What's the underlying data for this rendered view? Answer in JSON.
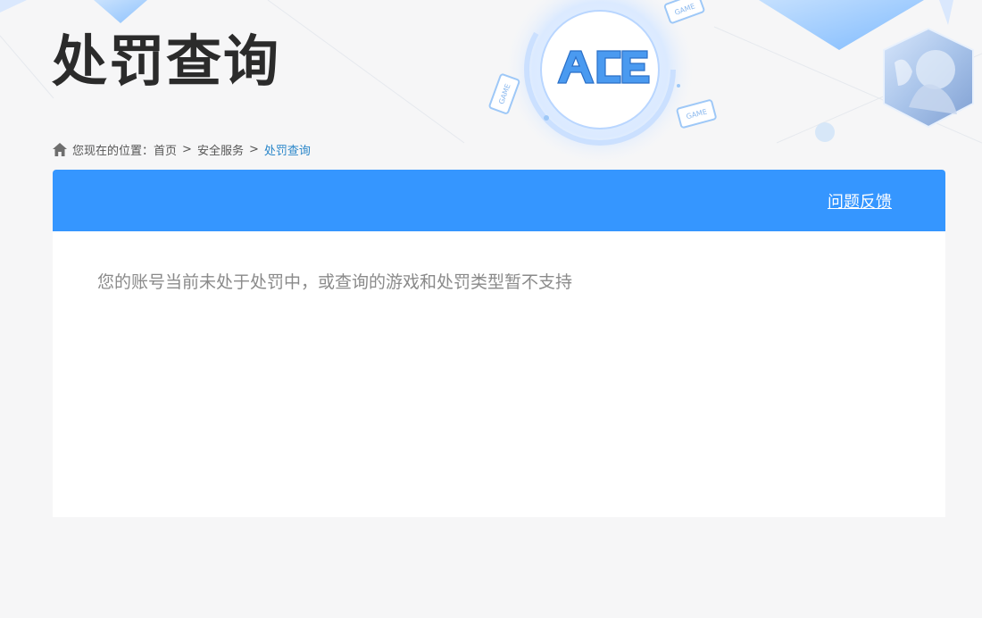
{
  "header": {
    "title": "处罚查询",
    "logo_text": "ACE",
    "badge_text": "GAME"
  },
  "breadcrumb": {
    "prefix": "您现在的位置：",
    "items": [
      "首页",
      "安全服务",
      "处罚查询"
    ],
    "separator": ">"
  },
  "panel": {
    "feedback_label": "问题反馈",
    "message": "您的账号当前未处于处罚中，或查询的游戏和处罚类型暂不支持"
  },
  "colors": {
    "accent": "#3596ff",
    "breadcrumb_current": "#2a86c9",
    "title": "#2b2b2b",
    "message": "#8a8a8a",
    "background": "#f6f6f7"
  },
  "icons": {
    "breadcrumb": "home-icon",
    "logo": "ace-logo-icon"
  }
}
